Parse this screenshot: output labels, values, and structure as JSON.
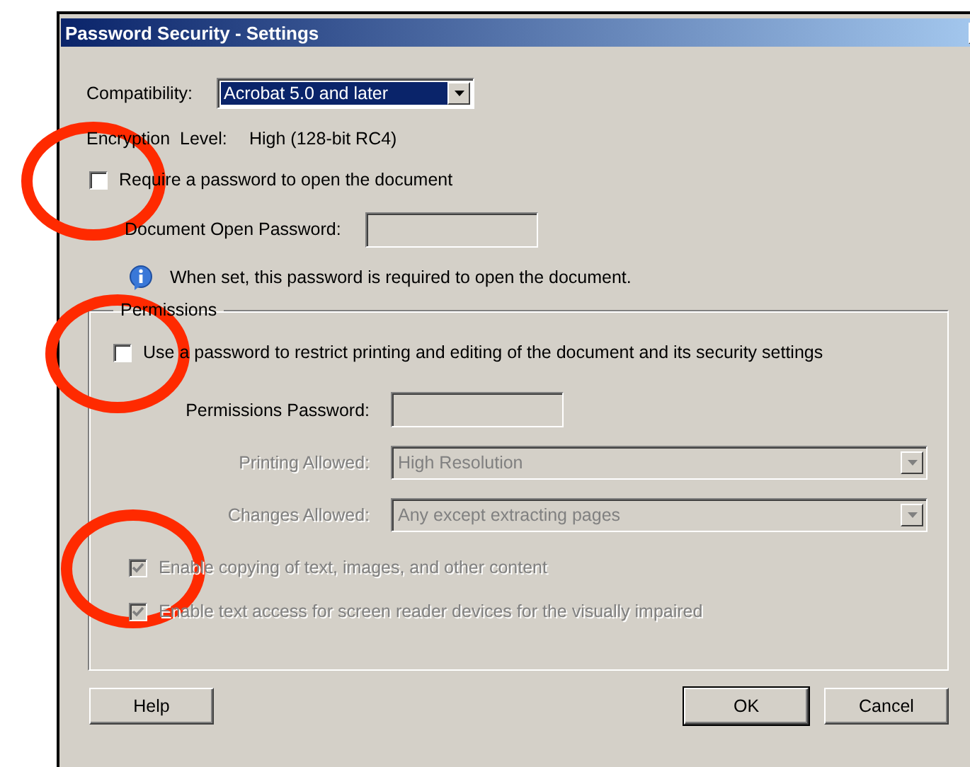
{
  "window": {
    "title": "Password Security - Settings"
  },
  "compatibility": {
    "label": "Compatibility:",
    "value": "Acrobat 5.0 and later"
  },
  "encryption": {
    "label": "Encryption  Level:",
    "value": "High (128-bit RC4)"
  },
  "open_password": {
    "checkbox": {
      "label": "Require a password to open the document",
      "checked": false,
      "circled": true
    },
    "field": {
      "label": "Document Open Password:"
    },
    "info": "When set, this password is required to open the document."
  },
  "permissions": {
    "title": "Permissions",
    "checkbox": {
      "label": "Use a password to restrict printing and editing of the document and its security settings",
      "checked": false,
      "circled": true
    },
    "field": {
      "label": "Permissions Password:"
    },
    "selects": [
      {
        "label": "Printing Allowed:",
        "value": "High Resolution",
        "disabled": true
      },
      {
        "label": "Changes Allowed:",
        "value": "Any except extracting pages",
        "disabled": true
      }
    ],
    "options": [
      {
        "label": "Enable copying of text, images, and other content",
        "checked": true,
        "disabled": true,
        "circled": true
      },
      {
        "label": "Enable text access for screen reader devices for the visually impaired",
        "checked": true,
        "disabled": true,
        "circled": false
      }
    ]
  },
  "buttons": [
    {
      "label": "Help",
      "default": false
    },
    {
      "label": "OK",
      "default": true
    },
    {
      "label": "Cancel",
      "default": false
    }
  ]
}
